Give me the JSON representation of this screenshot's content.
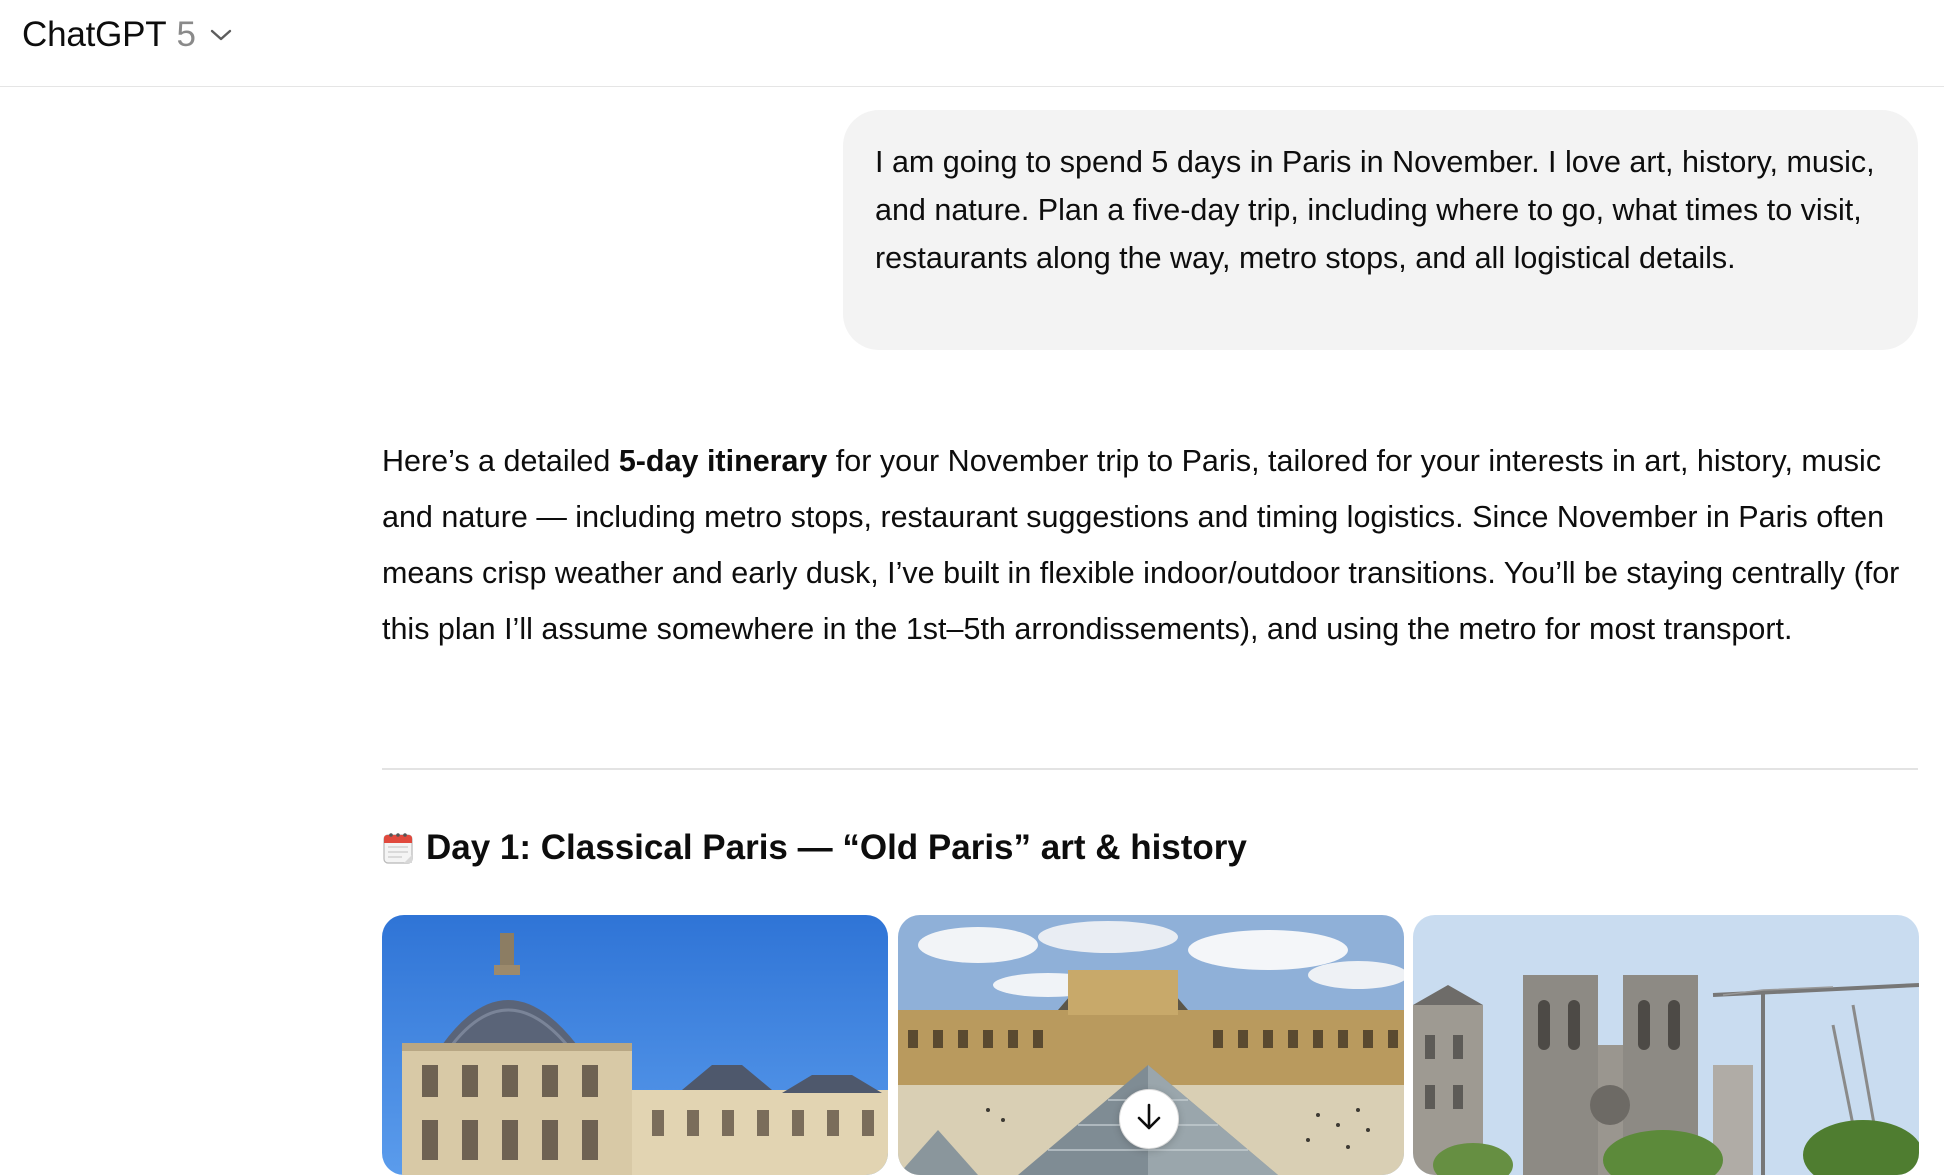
{
  "header": {
    "app_title": "ChatGPT",
    "model_version": "5",
    "chevron_icon": "chevron-down-icon"
  },
  "user_message": {
    "text": "I am going to spend 5 days in Paris in November. I love art, history, music, and nature. Plan a five-day trip, including where to go, what times to visit, restaurants along the way, metro stops, and all logistical details."
  },
  "assistant_message": {
    "intro_before_bold": "Here’s a detailed ",
    "intro_bold": "5-day itinerary",
    "intro_after_bold": " for your November trip to Paris, tailored for your interests in art, history, music and nature — including metro stops, restaurant suggestions and timing logistics. Since November in Paris often means crisp weather and early dusk, I’ve built in flexible indoor/outdoor transitions. You’ll be staying centrally (for this plan I’ll assume somewhere in the 1st–5th arrondissements), and using the metro for most transport.",
    "day1_heading": "Day 1: Classical Paris — “Old Paris” art & history",
    "day1_heading_icon": "calendar-icon",
    "gallery_images": [
      {
        "subject": "Louvre palace pavilion against blue sky",
        "icon": "image-louvre-pavilion"
      },
      {
        "subject": "Louvre courtyard and glass pyramid",
        "icon": "image-louvre-pyramid"
      },
      {
        "subject": "Notre-Dame towers with construction crane",
        "icon": "image-notre-dame"
      }
    ]
  },
  "scroll_button": {
    "icon": "arrow-down-icon"
  },
  "colors": {
    "user_bubble_bg": "#f3f3f3",
    "text": "#0d0d0d",
    "muted": "#8a8a8a",
    "divider": "#e3e3e3"
  }
}
